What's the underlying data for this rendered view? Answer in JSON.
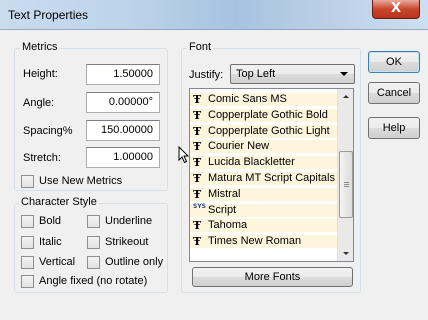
{
  "window": {
    "title": "Text Properties",
    "close_glyph": "X"
  },
  "metrics": {
    "legend": "Metrics",
    "height_label": "Height:",
    "height_value": "1.50000",
    "angle_label": "Angle:",
    "angle_value": "0.00000°",
    "spacing_label": "Spacing%",
    "spacing_value": "150.00000",
    "stretch_label": "Stretch:",
    "stretch_value": "1.00000",
    "use_new_metrics": "Use New Metrics"
  },
  "character_style": {
    "legend": "Character Style",
    "bold": "Bold",
    "underline": "Underline",
    "italic": "Italic",
    "strikeout": "Strikeout",
    "vertical": "Vertical",
    "outline_only": "Outline only",
    "angle_fixed": "Angle fixed (no rotate)"
  },
  "font": {
    "legend": "Font",
    "justify_label": "Justify:",
    "justify_value": "Top Left",
    "items": [
      {
        "icon": "truetype-icon",
        "glyph": "Ŧ",
        "name": "Comic Sans MS"
      },
      {
        "icon": "truetype-icon",
        "glyph": "Ŧ",
        "name": "Copperplate Gothic Bold"
      },
      {
        "icon": "truetype-icon",
        "glyph": "Ŧ",
        "name": "Copperplate Gothic Light"
      },
      {
        "icon": "truetype-icon",
        "glyph": "Ŧ",
        "name": "Courier New"
      },
      {
        "icon": "truetype-icon",
        "glyph": "Ŧ",
        "name": "Lucida Blackletter"
      },
      {
        "icon": "truetype-icon",
        "glyph": "Ŧ",
        "name": "Matura MT Script Capitals"
      },
      {
        "icon": "truetype-icon",
        "glyph": "Ŧ",
        "name": "Mistral"
      },
      {
        "icon": "system-font-icon",
        "glyph": "SYS",
        "name": "Script"
      },
      {
        "icon": "truetype-icon",
        "glyph": "Ŧ",
        "name": "Tahoma"
      },
      {
        "icon": "truetype-icon",
        "glyph": "Ŧ",
        "name": "Times New Roman"
      }
    ],
    "more_fonts": "More Fonts"
  },
  "buttons": {
    "ok": "OK",
    "cancel": "Cancel",
    "help": "Help"
  }
}
